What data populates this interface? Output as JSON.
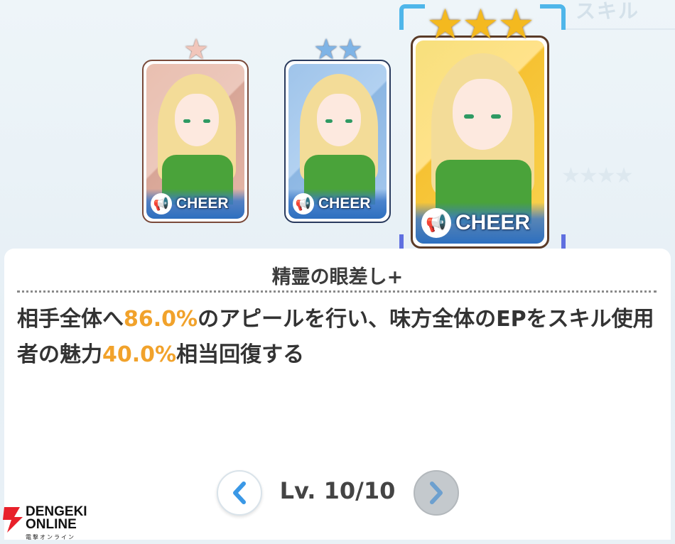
{
  "background": {
    "faded_label": "スキル"
  },
  "cards": [
    {
      "rarity_stars": 1,
      "stars_text": "★",
      "badge_text": "CHEER",
      "selected": false
    },
    {
      "rarity_stars": 2,
      "stars_text": "★★",
      "badge_text": "CHEER",
      "selected": false
    },
    {
      "rarity_stars": 3,
      "stars_text": "★★★",
      "badge_text": "CHEER",
      "selected": true
    }
  ],
  "skill": {
    "name": "精霊の眼差し+",
    "desc_part1": "相手全体へ",
    "value1": "86.0%",
    "desc_part2": "のアピールを行い、味方全体のEPをスキル使用者の魅力",
    "value2": "40.0%",
    "desc_part3": "相当回復する"
  },
  "pager": {
    "level_text": "Lv. 10/10",
    "prev_icon": "chevron-left-icon",
    "next_icon": "chevron-right-icon"
  },
  "watermark": {
    "line1": "DENGEKI",
    "line2": "ONLINE",
    "line3": "電撃オンライン"
  },
  "colors": {
    "highlight": "#f1a22b",
    "accent_blue": "#3a98e6"
  }
}
